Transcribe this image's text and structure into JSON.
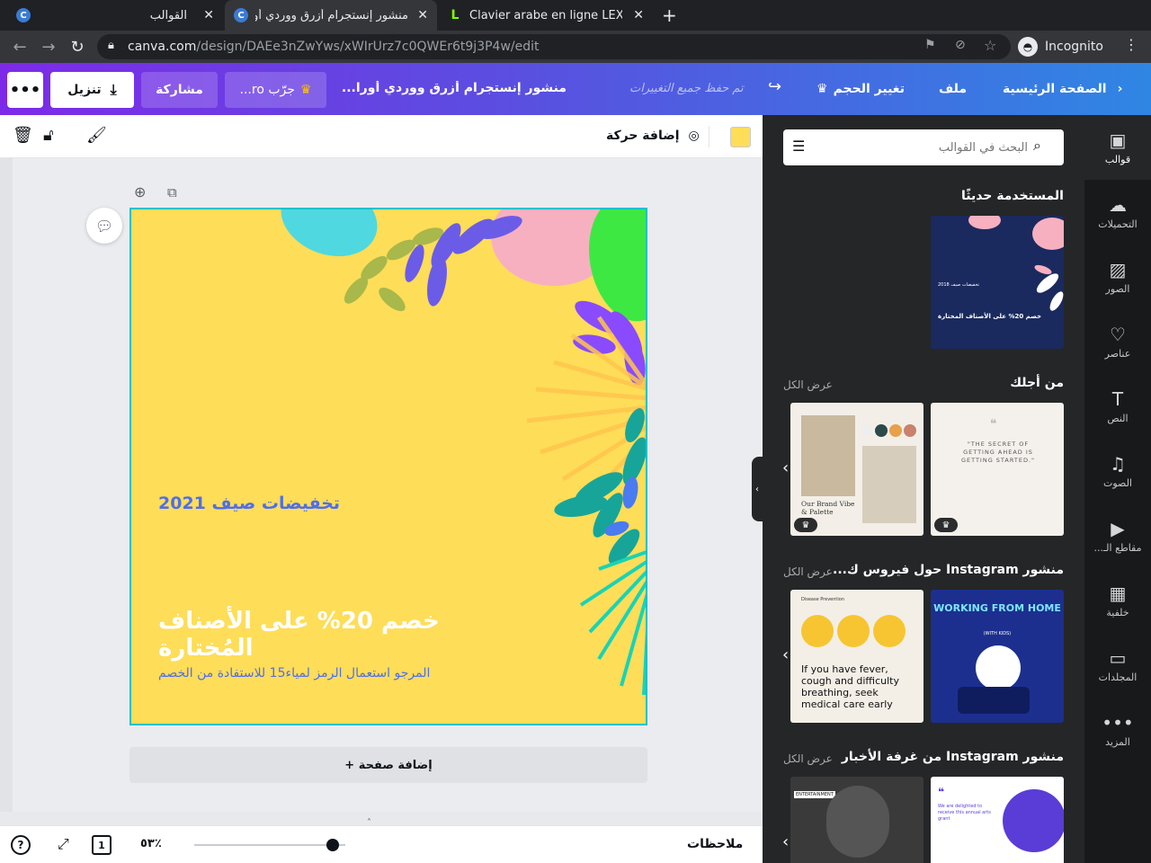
{
  "browser": {
    "tabs": [
      {
        "title": "القوالب",
        "favicon": "C"
      },
      {
        "title": "منشور إنستجرام أزرق ووردي أو",
        "favicon": "C"
      },
      {
        "title": "Clavier arabe en ligne LEXI",
        "favicon": "L"
      }
    ],
    "url_host": "canva.com",
    "url_path": "/design/DAEe3nZwYws/xWIrUrz7c0QWEr6t9j3P4w/edit",
    "profile_label": "Incognito"
  },
  "header": {
    "home": "الصفحة الرئيسية",
    "file": "ملف",
    "resize": "تغيير الحجم",
    "save_status": "تم حفظ جميع التغييرات",
    "doc_title": "منشور إنستجرام أزرق ووردي أورا...",
    "try_pro": "جرّب ro...",
    "share": "مشاركة",
    "download": "تنزيل"
  },
  "toolbar": {
    "animate": "إضافة حركة",
    "color": "#fedd58"
  },
  "design": {
    "subtitle": "تخفيضات صيف 2021",
    "headline": "خصم 20% على الأصناف المُختارة",
    "body": "المرجو استعمال الرمز لمياء15 للاستفادة من الخصم"
  },
  "canvas": {
    "add_page": "+ إضافة صفحة"
  },
  "bottombar": {
    "notes": "ملاحظات",
    "zoom": "٥٣٪",
    "page": "1",
    "help": "?"
  },
  "panel": {
    "search_placeholder": "البحث في القوالب",
    "recent_title": "المستخدمة حديثًا",
    "recent_thumb": {
      "small": "تخفيضات صيف 2018",
      "main": "خصم 20% على الأصناف المختارة",
      "bg": "#1a2a5e"
    },
    "sections": [
      {
        "title": "من أجلك",
        "see_all": "عرض الكل",
        "items": [
          {
            "text": "\"THE SECRET OF GETTING AHEAD IS GETTING STARTED.\"",
            "bg": "#f4f1ec"
          },
          {
            "text": "Our Brand Vibe & Palette",
            "bg": "#f3efe8"
          }
        ]
      },
      {
        "title": "منشور Instagram حول فيروس ك...",
        "see_all": "عرض الكل",
        "items": [
          {
            "text": "WORKING FROM HOME",
            "sub": "(WITH KIDS)",
            "bg": "#1c2f8f"
          },
          {
            "text": "If you have fever, cough and difficulty breathing, seek medical care early",
            "sub": "Disease Prevention",
            "bg": "#f3efe7"
          }
        ]
      },
      {
        "title": "منشور Instagram من غرفة الأخبار",
        "see_all": "عرض الكل",
        "items": [
          {
            "text": "We are delighted to receive this annual arts grant",
            "bg": "#ffffff"
          },
          {
            "text": "ENTERTAINMENT",
            "bg": "#3a3a3a"
          }
        ]
      }
    ]
  },
  "sidebar": {
    "items": [
      {
        "label": "قوالب",
        "icon": "template-icon",
        "glyph": "▣"
      },
      {
        "label": "التحميلات",
        "icon": "upload-icon",
        "glyph": "☁"
      },
      {
        "label": "الصور",
        "icon": "photo-icon",
        "glyph": "▨"
      },
      {
        "label": "عناصر",
        "icon": "elements-icon",
        "glyph": "♡"
      },
      {
        "label": "النص",
        "icon": "text-icon",
        "glyph": "T"
      },
      {
        "label": "الصوت",
        "icon": "audio-icon",
        "glyph": "♫"
      },
      {
        "label": "مقاطع الـ...",
        "icon": "video-icon",
        "glyph": "▶"
      },
      {
        "label": "خلفية",
        "icon": "background-icon",
        "glyph": "▦"
      },
      {
        "label": "المجلدات",
        "icon": "folder-icon",
        "glyph": "▭"
      },
      {
        "label": "المزيد",
        "icon": "more-icon",
        "glyph": "•••"
      }
    ]
  }
}
